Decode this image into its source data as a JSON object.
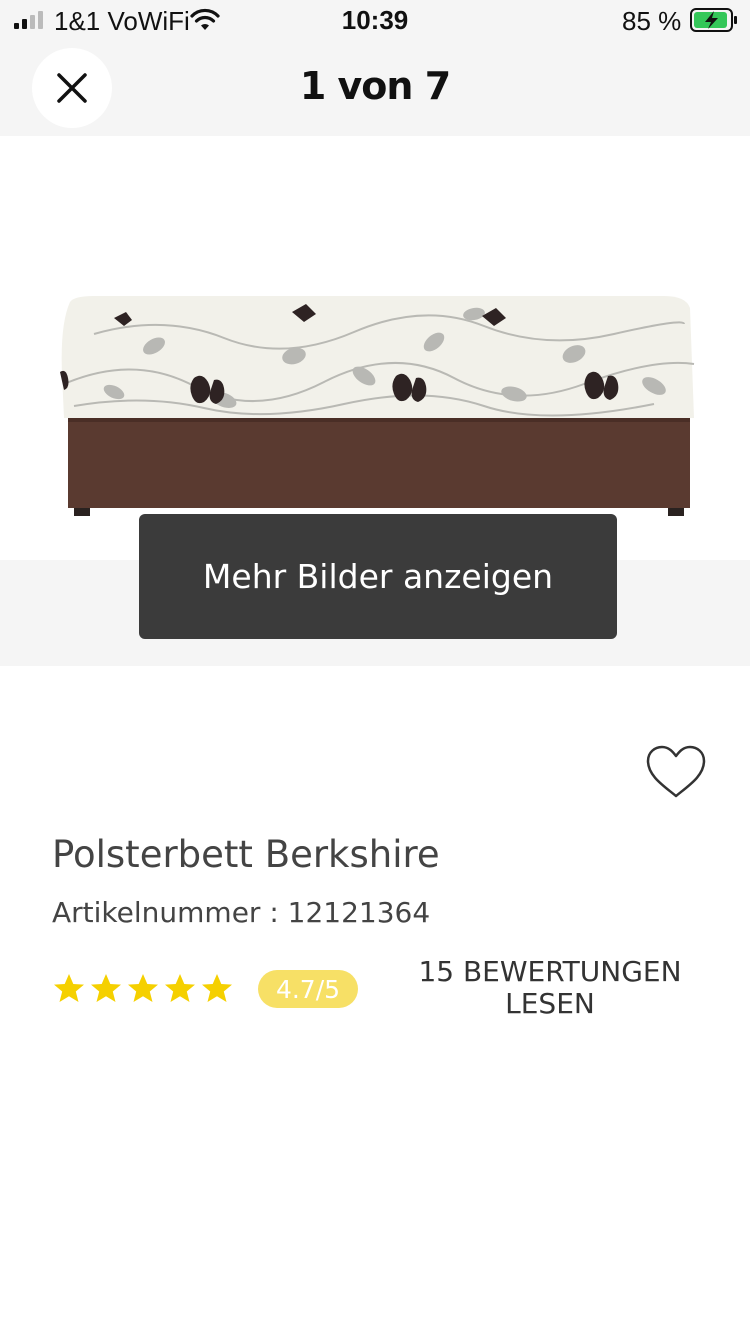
{
  "status_bar": {
    "carrier": "1&1 VoWiFi",
    "time": "10:39",
    "battery": "85 %"
  },
  "header": {
    "title": "1 von 7"
  },
  "gallery": {
    "more_images_label": "Mehr Bilder anzeigen"
  },
  "product": {
    "title": "Polsterbett Berkshire",
    "article_number": "Artikelnummer : 12121364",
    "rating": {
      "stars": 5,
      "badge": "4.7/5",
      "value": 4.7,
      "max": 5
    },
    "reviews_link": {
      "line1": "15 BEWERTUNGEN",
      "line2": "LESEN"
    }
  },
  "colors": {
    "star": "#f5d000",
    "badge": "#f7e066",
    "button_bg": "#3b3b3b",
    "bed_base": "#5a3a30"
  }
}
